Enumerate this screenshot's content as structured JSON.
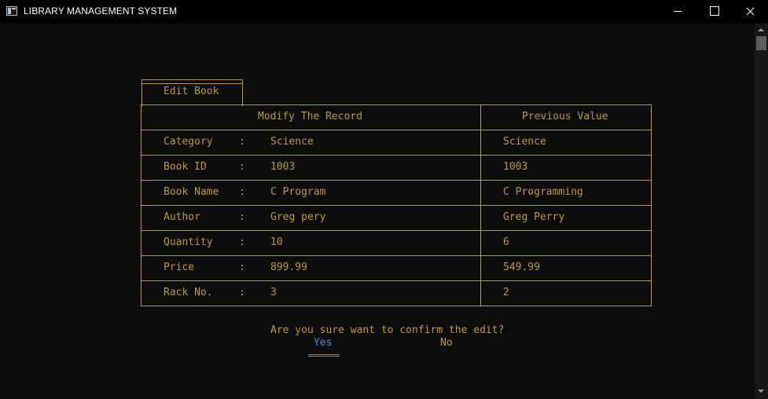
{
  "window": {
    "title": "LIBRARY MANAGEMENT SYSTEM",
    "icon": "console-app-icon",
    "controls": [
      "minimize",
      "maximize",
      "close"
    ]
  },
  "form": {
    "tab_label": "Edit Book",
    "header_left": "Modify The Record",
    "header_right": "Previous Value",
    "separator": ":",
    "rows": [
      {
        "field": "Category",
        "new_value": "Science",
        "previous_value": "Science"
      },
      {
        "field": "Book ID",
        "new_value": "1003",
        "previous_value": "1003"
      },
      {
        "field": "Book Name",
        "new_value": "C Program",
        "previous_value": "C Programming"
      },
      {
        "field": "Author",
        "new_value": "Greg pery",
        "previous_value": "Greg Perry"
      },
      {
        "field": "Quantity",
        "new_value": "10",
        "previous_value": "6"
      },
      {
        "field": "Price",
        "new_value": "899.99",
        "previous_value": "549.99"
      },
      {
        "field": "Rack No.",
        "new_value": "3",
        "previous_value": "2"
      }
    ]
  },
  "confirm": {
    "prompt": "Are you sure want to confirm the edit?",
    "yes_label": "Yes",
    "no_label": "No",
    "selected": "Yes"
  },
  "colors": {
    "text": "#c19a2c",
    "selected": "#3a96dd",
    "background": "#0c0c0c",
    "titlebar": "#000000"
  }
}
